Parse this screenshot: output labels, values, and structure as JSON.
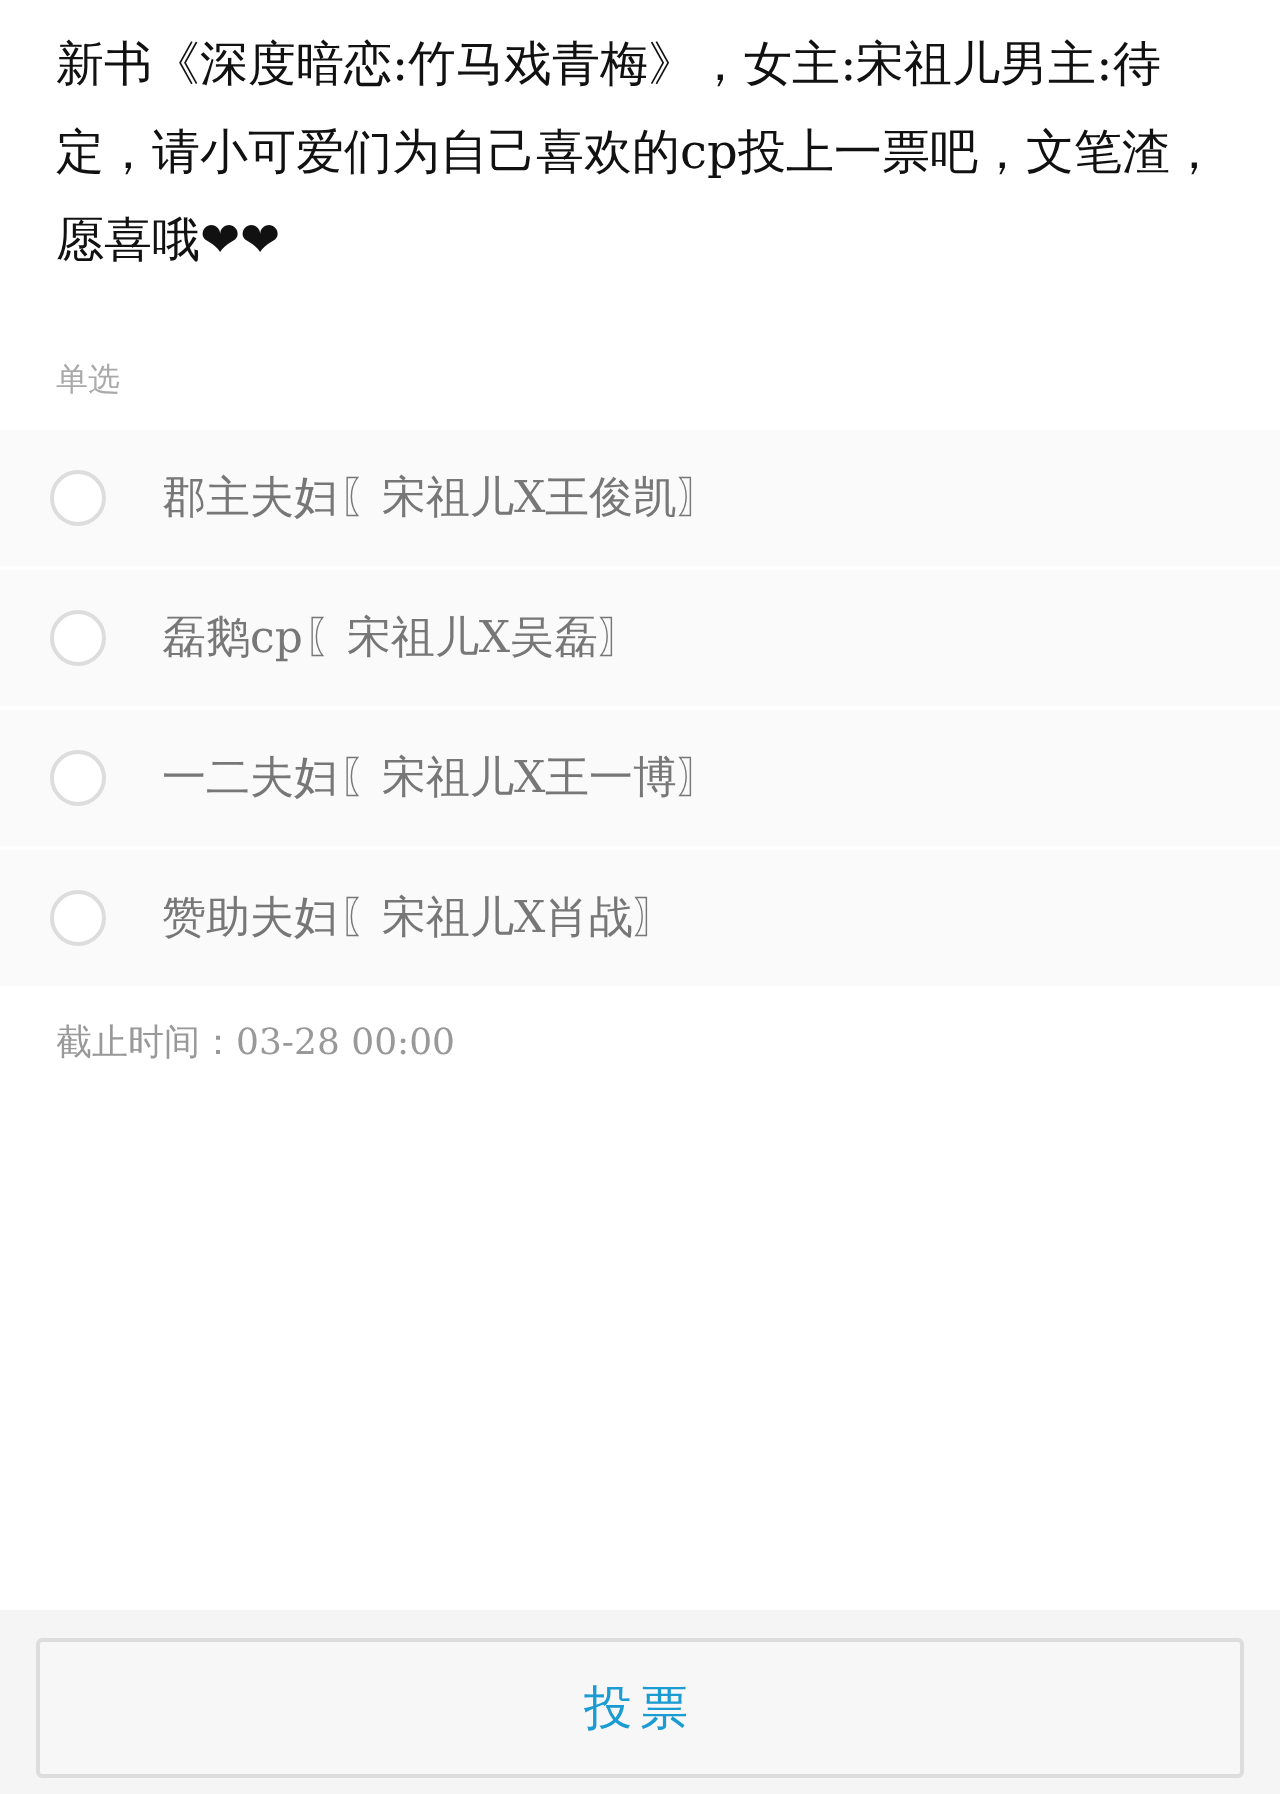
{
  "title": "新书《深度暗恋:竹马戏青梅》，女主:宋祖儿男主:待定，请小可爱们为自己喜欢的cp投上一票吧，文笔渣，愿喜哦❤❤",
  "vote_type": "单选",
  "options": [
    {
      "label": "郡主夫妇〖宋祖儿X王俊凯〗",
      "selected": false
    },
    {
      "label": "磊鹅cp〖宋祖儿X吴磊〗",
      "selected": false
    },
    {
      "label": "一二夫妇〖宋祖儿X王一博〗",
      "selected": false
    },
    {
      "label": "赞助夫妇〖宋祖儿X肖战〗",
      "selected": false
    }
  ],
  "deadline": "截止时间：03-28 00:00",
  "submit_button": "投票"
}
